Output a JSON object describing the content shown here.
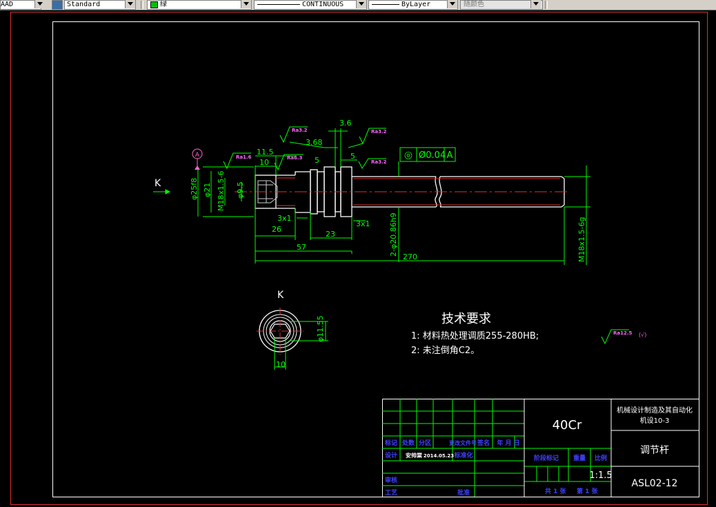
{
  "toolbar": {
    "textstyle_prefix": "AAD",
    "dimstyle": "Standard",
    "layer_color_label": "绿",
    "linetype": "CONTINUOUS",
    "lineweight": "ByLayer",
    "plotstyle": "随颜色",
    "layer_color": "#00c000"
  },
  "drawing": {
    "datum_letter": "A",
    "view_label_main": "K",
    "view_label_section": "K",
    "dims": {
      "d36": "3.6",
      "d368": "3.68",
      "d115": "11.5",
      "d10a": "10",
      "d5a": "5",
      "d5b": "5",
      "d3x1a": "3x1",
      "d26": "26",
      "d3x1b": "3x1",
      "d23": "23",
      "d57": "57",
      "d270": "270",
      "dphi25": "φ25f8",
      "dphi21": "φ21",
      "dm18a": "M18x1.5-6",
      "dphi95": "φ9.5",
      "dphi2086": "2-φ20.86h9",
      "dm18b": "M18x1.5-6g",
      "dphi1155": "φ11.55",
      "d10b": "10"
    },
    "roughness": {
      "r1": "Ra3.2",
      "r2": "Ra3.2",
      "r3": "Ra1.6",
      "r4": "Ra6.3",
      "r5": "Ra3.2",
      "r_rest": "Ra12.5",
      "r_rest_suffix": "(√)"
    },
    "tolerance": {
      "symbol": "◎",
      "value": "Ø0.04",
      "datum": "A"
    },
    "tech_req": {
      "title": "技术要求",
      "line1": "1: 材料热处理调质255-280HB;",
      "line2": "2: 未注倒角C2。"
    }
  },
  "titleblock": {
    "material": "40Cr",
    "org_line1": "机械设计制造及其自动化",
    "org_line2": "机设10-3",
    "part_name": "调节杆",
    "drawing_no": "ASL02-12",
    "scale": "1:1.5",
    "hdr_mark": "标记",
    "hdr_count": "处数",
    "hdr_zone": "分区",
    "hdr_docno": "更改文件号",
    "hdr_sign": "签名",
    "hdr_date": "年 月 日",
    "lbl_design": "设计",
    "designer": "安帅棠",
    "design_date": "2014.05.23",
    "lbl_std": "标准化",
    "lbl_stage": "阶段标记",
    "lbl_weight": "重量",
    "lbl_scale": "比例",
    "lbl_review": "审核",
    "lbl_process": "工艺",
    "lbl_approve": "批准",
    "sheets_total": "共  1  张",
    "sheet_no": "第  1  张"
  }
}
